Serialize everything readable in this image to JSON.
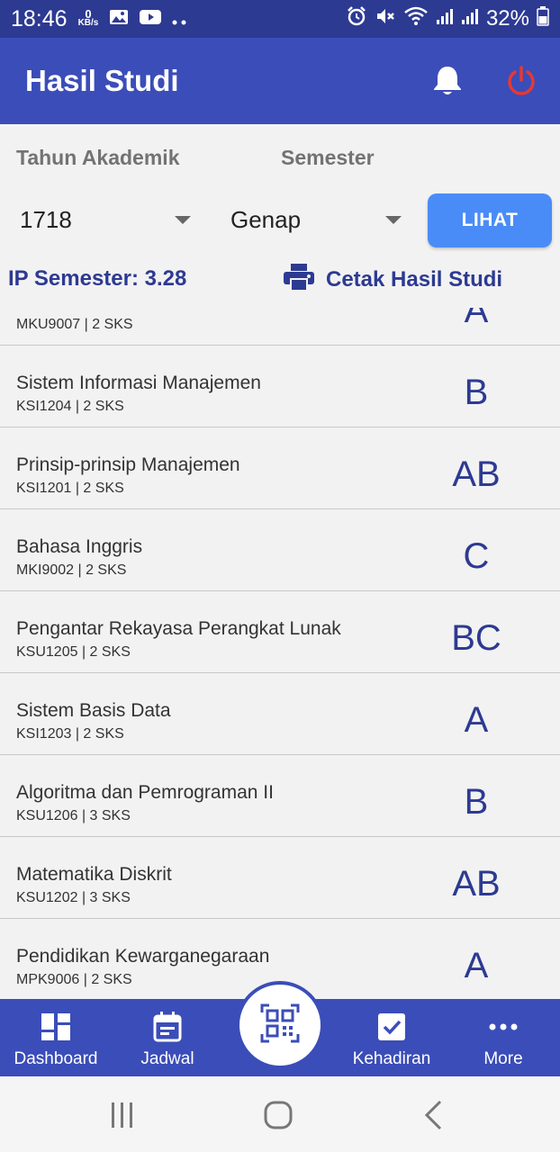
{
  "status_bar": {
    "time": "18:46",
    "net_speed_value": "0",
    "net_speed_unit": "KB/s",
    "battery": "32%"
  },
  "app_bar": {
    "title": "Hasil Studi"
  },
  "filters": {
    "year_label": "Tahun Akademik",
    "year_value": "1718",
    "semester_label": "Semester",
    "semester_value": "Genap",
    "button_label": "LIHAT",
    "ip_semester": "IP Semester: 3.28",
    "print_label": "Cetak Hasil Studi"
  },
  "courses": [
    {
      "name": "",
      "code": "MKU9007 | 2 SKS",
      "grade": "A"
    },
    {
      "name": "Sistem Informasi Manajemen",
      "code": "KSI1204 | 2 SKS",
      "grade": "B"
    },
    {
      "name": "Prinsip-prinsip Manajemen",
      "code": "KSI1201 | 2 SKS",
      "grade": "AB"
    },
    {
      "name": "Bahasa Inggris",
      "code": "MKI9002 | 2 SKS",
      "grade": "C"
    },
    {
      "name": "Pengantar Rekayasa Perangkat Lunak",
      "code": "KSU1205 | 2 SKS",
      "grade": "BC"
    },
    {
      "name": "Sistem Basis Data",
      "code": "KSI1203 | 2 SKS",
      "grade": "A"
    },
    {
      "name": "Algoritma dan Pemrograman II",
      "code": "KSU1206 | 3 SKS",
      "grade": "B"
    },
    {
      "name": "Matematika Diskrit",
      "code": "KSU1202 | 3 SKS",
      "grade": "AB"
    },
    {
      "name": "Pendidikan Kewarganegaraan",
      "code": "MPK9006 | 2 SKS",
      "grade": "A"
    }
  ],
  "bottom_nav": {
    "dashboard": "Dashboard",
    "jadwal": "Jadwal",
    "kehadiran": "Kehadiran",
    "more": "More"
  },
  "colors": {
    "primary": "#3b4db8",
    "status_bar": "#2d3a92",
    "accent_button": "#4a8cf7",
    "power_icon": "#e53935",
    "grade_text": "#2d3a92"
  }
}
